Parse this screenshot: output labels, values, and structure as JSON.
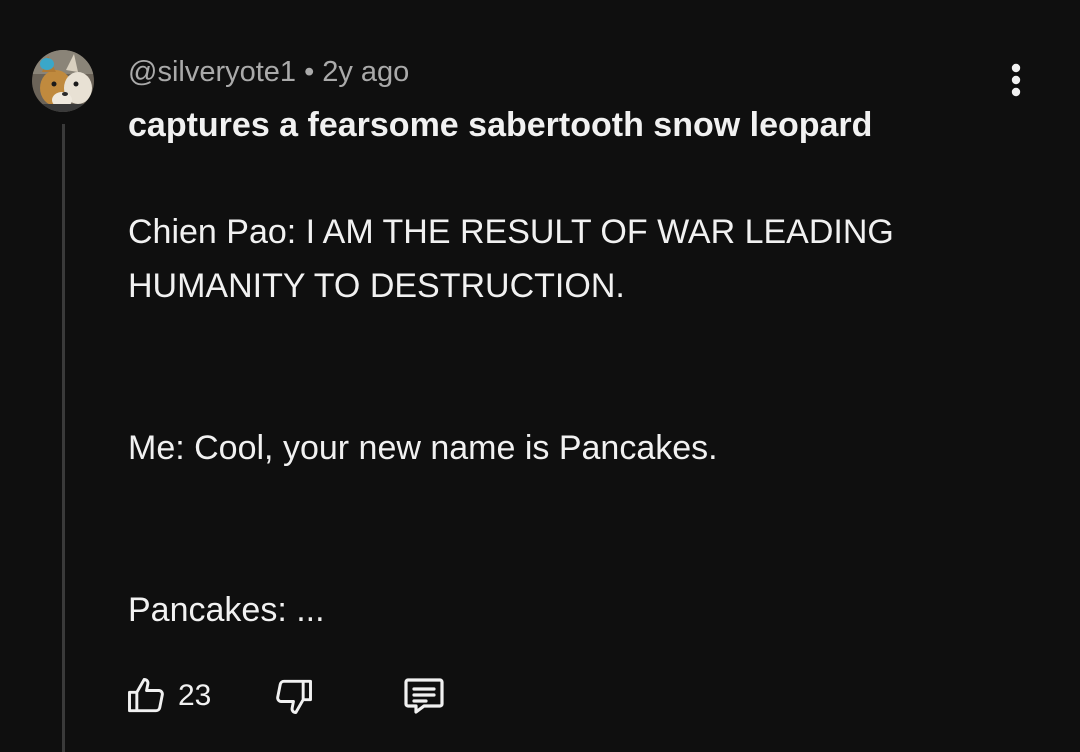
{
  "comment": {
    "author": "@silveryote1",
    "separator": "•",
    "timestamp": "2y ago",
    "title": "captures a fearsome sabertooth snow leopard",
    "paragraphs": [
      "Chien Pao: I AM THE RESULT OF WAR LEADING HUMANITY TO DESTRUCTION.",
      "Me: Cool, your new name is Pancakes.",
      "Pancakes: ..."
    ],
    "like_count": "23"
  },
  "icons": {
    "avatar": "avatar-image",
    "menu": "more-vert-icon",
    "like": "thumb-up-icon",
    "dislike": "thumb-down-icon",
    "reply": "comment-reply-icon"
  },
  "colors": {
    "background": "#0f0f0f",
    "text_primary": "#f1f1f1",
    "text_secondary": "#aaaaaa",
    "thread_line": "#3a3a3a"
  }
}
